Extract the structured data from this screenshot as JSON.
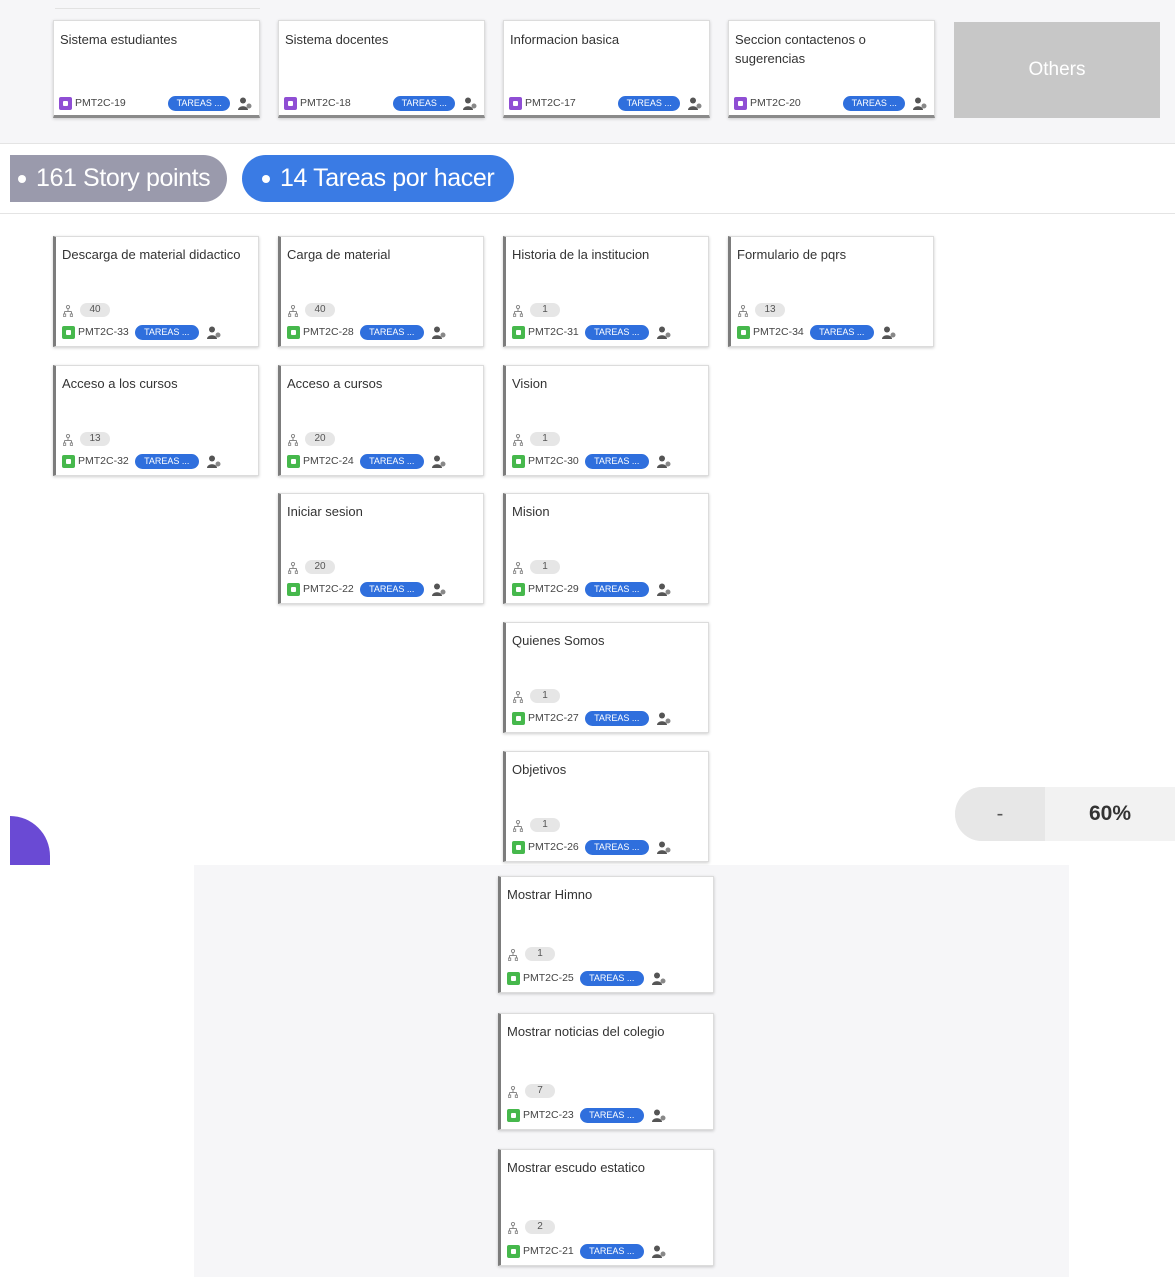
{
  "epics": [
    {
      "title": "Sistema estudiantes",
      "key": "PMT2C-19",
      "status": "TAREAS ..."
    },
    {
      "title": "Sistema docentes",
      "key": "PMT2C-18",
      "status": "TAREAS ..."
    },
    {
      "title": "Informacion basica",
      "key": "PMT2C-17",
      "status": "TAREAS ..."
    },
    {
      "title": "Seccion contactenos o sugerencias",
      "key": "PMT2C-20",
      "status": "TAREAS ..."
    }
  ],
  "others_label": "Others",
  "summary": {
    "story_points": "161 Story points",
    "tasks_todo": "14 Tareas por hacer"
  },
  "columns": [
    [
      {
        "title": "Descarga de material didactico",
        "points": "40",
        "key": "PMT2C-33",
        "status": "TAREAS ..."
      },
      {
        "title": "Acceso a los cursos",
        "points": "13",
        "key": "PMT2C-32",
        "status": "TAREAS ..."
      }
    ],
    [
      {
        "title": "Carga de material",
        "points": "40",
        "key": "PMT2C-28",
        "status": "TAREAS ..."
      },
      {
        "title": "Acceso a cursos",
        "points": "20",
        "key": "PMT2C-24",
        "status": "TAREAS ..."
      },
      {
        "title": "Iniciar sesion",
        "points": "20",
        "key": "PMT2C-22",
        "status": "TAREAS ..."
      }
    ],
    [
      {
        "title": "Historia de la institucion",
        "points": "1",
        "key": "PMT2C-31",
        "status": "TAREAS ..."
      },
      {
        "title": "Vision",
        "points": "1",
        "key": "PMT2C-30",
        "status": "TAREAS ..."
      },
      {
        "title": "Mision",
        "points": "1",
        "key": "PMT2C-29",
        "status": "TAREAS ..."
      },
      {
        "title": "Quienes Somos",
        "points": "1",
        "key": "PMT2C-27",
        "status": "TAREAS ..."
      },
      {
        "title": "Objetivos",
        "points": "1",
        "key": "PMT2C-26",
        "status": "TAREAS ..."
      },
      {
        "title": "Mostrar Himno",
        "points": "1",
        "key": "PMT2C-25",
        "status": "TAREAS ..."
      },
      {
        "title": "Mostrar noticias del colegio",
        "points": "7",
        "key": "PMT2C-23",
        "status": "TAREAS ..."
      },
      {
        "title": "Mostrar escudo estatico",
        "points": "2",
        "key": "PMT2C-21",
        "status": "TAREAS ..."
      }
    ],
    [
      {
        "title": "Formulario de pqrs",
        "points": "13",
        "key": "PMT2C-34",
        "status": "TAREAS ..."
      }
    ]
  ],
  "zoom": {
    "minus_label": "-",
    "level": "60%"
  },
  "colors": {
    "story_type": "#46b84c",
    "epic_type": "#8f4ed4",
    "status_badge": "#2f6fdd",
    "tasks_pill": "#3a7be4",
    "points_pill": "#9a9aac",
    "floating_button": "#6a4ad4"
  },
  "icons": {
    "story_points": "tree-icon",
    "assignee": "unassigned-user-icon",
    "issue_story": "story-type-icon",
    "issue_epic": "epic-type-icon"
  }
}
